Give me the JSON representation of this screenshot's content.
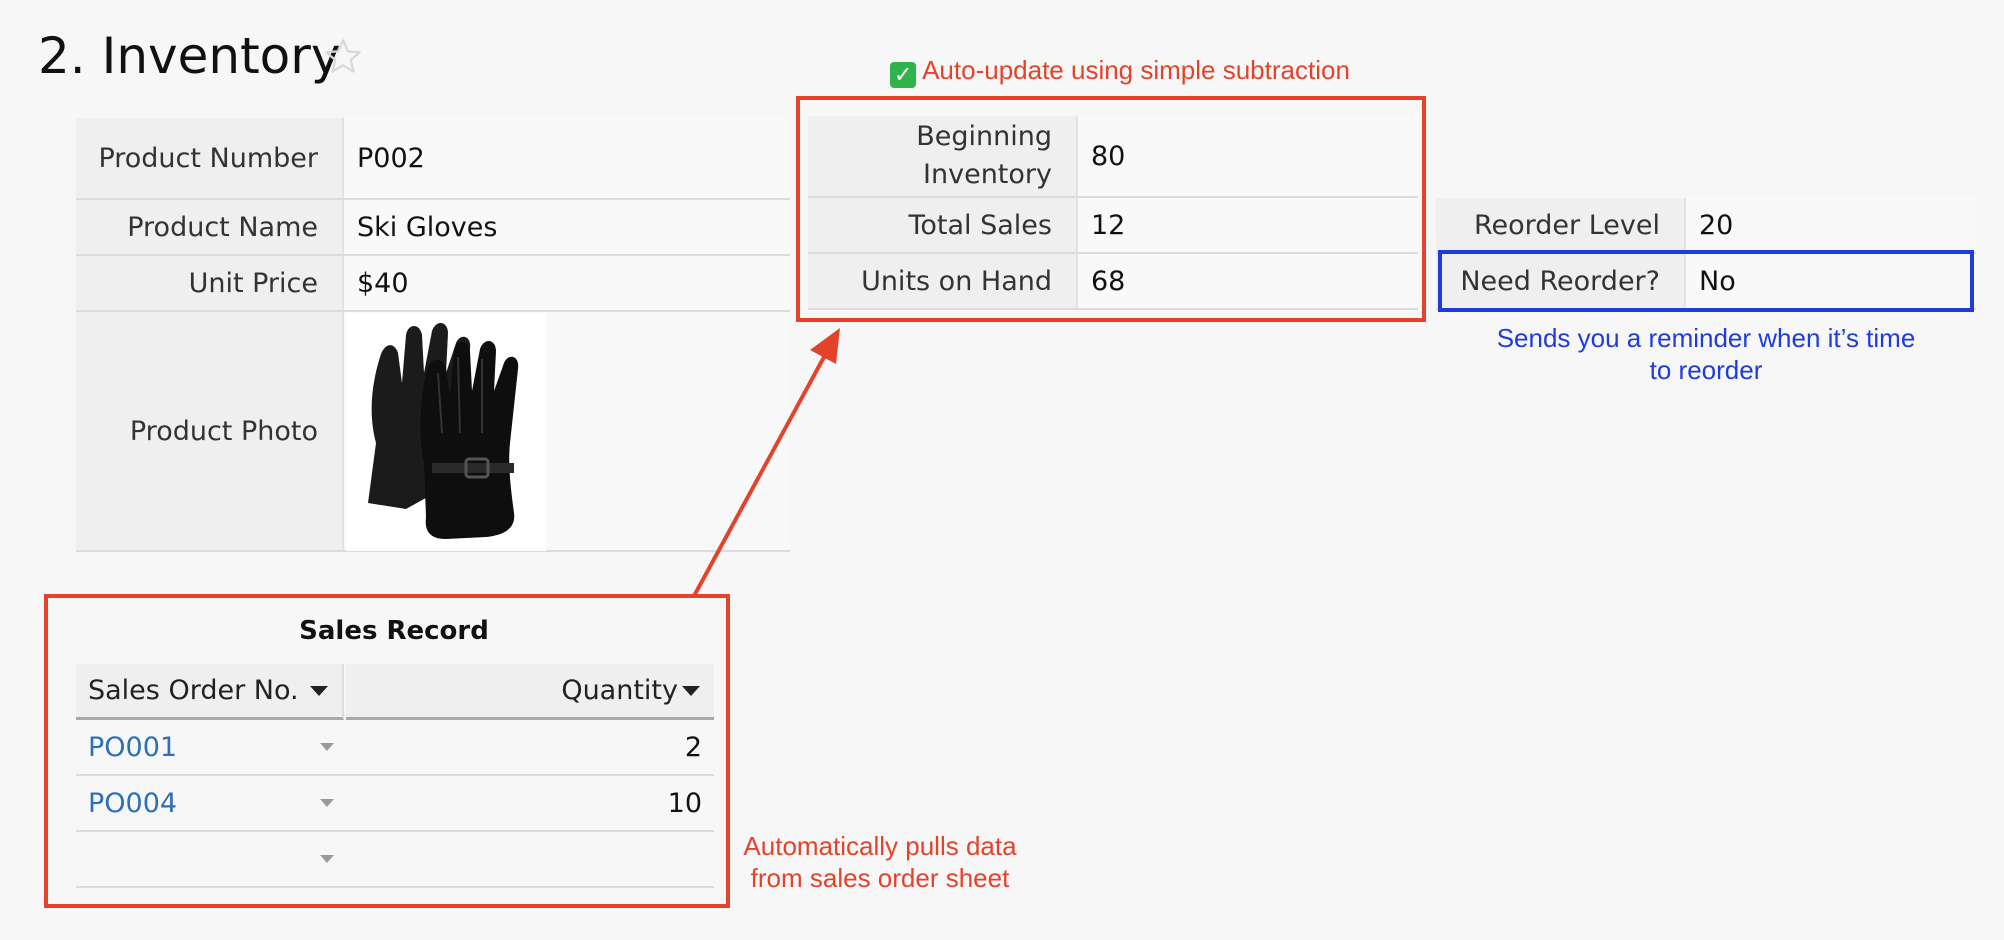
{
  "page": {
    "title": "2. Inventory",
    "favorite_icon": "star-outline-icon"
  },
  "product": {
    "fields": [
      {
        "label": "Product Number",
        "value": "P002"
      },
      {
        "label": "Product Name",
        "value": "Ski Gloves"
      },
      {
        "label": "Unit Price",
        "value": "$40"
      },
      {
        "label": "Product Photo",
        "value": ""
      }
    ],
    "photo_subject": "black ski gloves"
  },
  "inventory": {
    "beginning_label_1": "Beginning",
    "beginning_label_2": "Inventory",
    "beginning_value": "80",
    "total_sales_label": "Total Sales",
    "total_sales_value": "12",
    "units_on_hand_label": "Units on Hand",
    "units_on_hand_value": "68"
  },
  "reorder": {
    "level_label": "Reorder Level",
    "level_value": "20",
    "need_label": "Need Reorder?",
    "need_value": "No"
  },
  "sales_record": {
    "title": "Sales Record",
    "col_order": "Sales Order No.",
    "col_quantity": "Quantity",
    "rows": [
      {
        "order": "PO001",
        "quantity": "2"
      },
      {
        "order": "PO004",
        "quantity": "10"
      },
      {
        "order": "",
        "quantity": ""
      }
    ]
  },
  "annotations": {
    "auto_update": "Auto-update using simple subtraction",
    "auto_update_icon": "check-mark-icon",
    "reminder_line1": "Sends you a reminder when it’s time",
    "reminder_line2": "to reorder",
    "pulls_line1": "Automatically pulls data",
    "pulls_line2": "from sales order sheet"
  },
  "colors": {
    "annotation_red": "#e4432b",
    "annotation_blue": "#1f3be0",
    "link_blue": "#2e6fb8"
  }
}
